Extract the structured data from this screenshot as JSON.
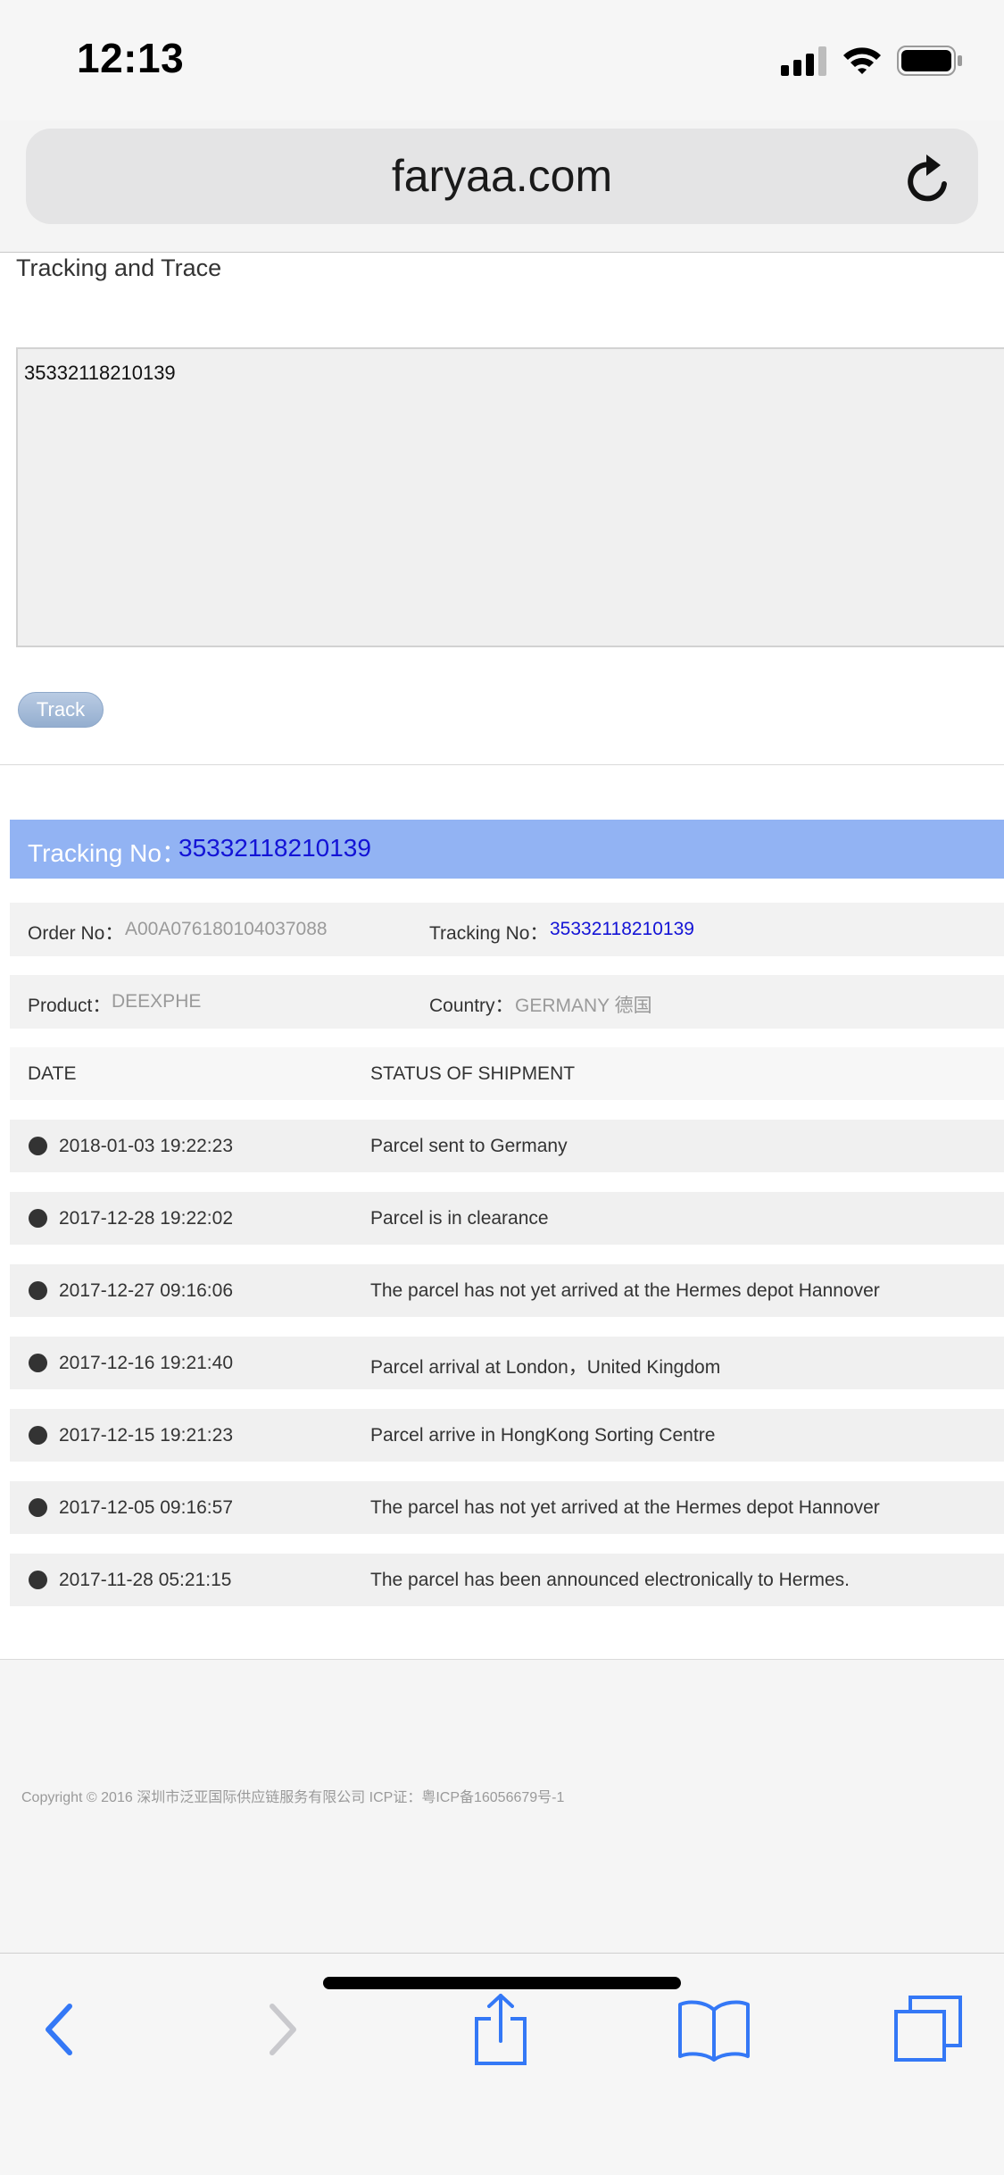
{
  "status_bar": {
    "time": "12:13",
    "icons": [
      "cellular-signal-icon",
      "wifi-icon",
      "battery-icon"
    ]
  },
  "browser": {
    "url": "faryaa.com",
    "reload_icon": "reload-icon"
  },
  "page": {
    "title": "Tracking and Trace",
    "input_value": "35332118210139",
    "track_button": "Track"
  },
  "result": {
    "header_label": "Tracking No：",
    "header_value": "35332118210139",
    "order_label": "Order No：",
    "order_value": "A00A076180104037088",
    "tracking_label": "Tracking No：",
    "tracking_value": "35332118210139",
    "product_label": "Product：",
    "product_value": "DEEXPHE",
    "country_label": "Country：",
    "country_value": "GERMANY  德国"
  },
  "table": {
    "columns": [
      "DATE",
      "STATUS OF SHIPMENT"
    ],
    "rows": [
      {
        "date": "2018-01-03 19:22:23",
        "status": "Parcel sent to Germany"
      },
      {
        "date": "2017-12-28 19:22:02",
        "status": "Parcel is in clearance"
      },
      {
        "date": "2017-12-27 09:16:06",
        "status": "The parcel has not yet arrived at the Hermes depot Hannover"
      },
      {
        "date": "2017-12-16 19:21:40",
        "status": "Parcel arrival at London，United Kingdom"
      },
      {
        "date": "2017-12-15 19:21:23",
        "status": "Parcel arrive in HongKong Sorting Centre"
      },
      {
        "date": "2017-12-05 09:16:57",
        "status": "The parcel has not yet arrived at the Hermes depot Hannover"
      },
      {
        "date": "2017-11-28 05:21:15",
        "status": "The parcel has been announced electronically to Hermes."
      }
    ]
  },
  "footer": {
    "copyright": "Copyright © 2016  深圳市泛亚国际供应链服务有限公司     ICP证：粤ICP备16056679号-1"
  },
  "toolbar": {
    "icons": [
      "back-icon",
      "forward-icon",
      "share-icon",
      "bookmarks-icon",
      "tabs-icon"
    ]
  },
  "colors": {
    "accent": "#3478f6",
    "result_header_bg": "#92b3f3",
    "tracking_blue": "#1313d6"
  }
}
